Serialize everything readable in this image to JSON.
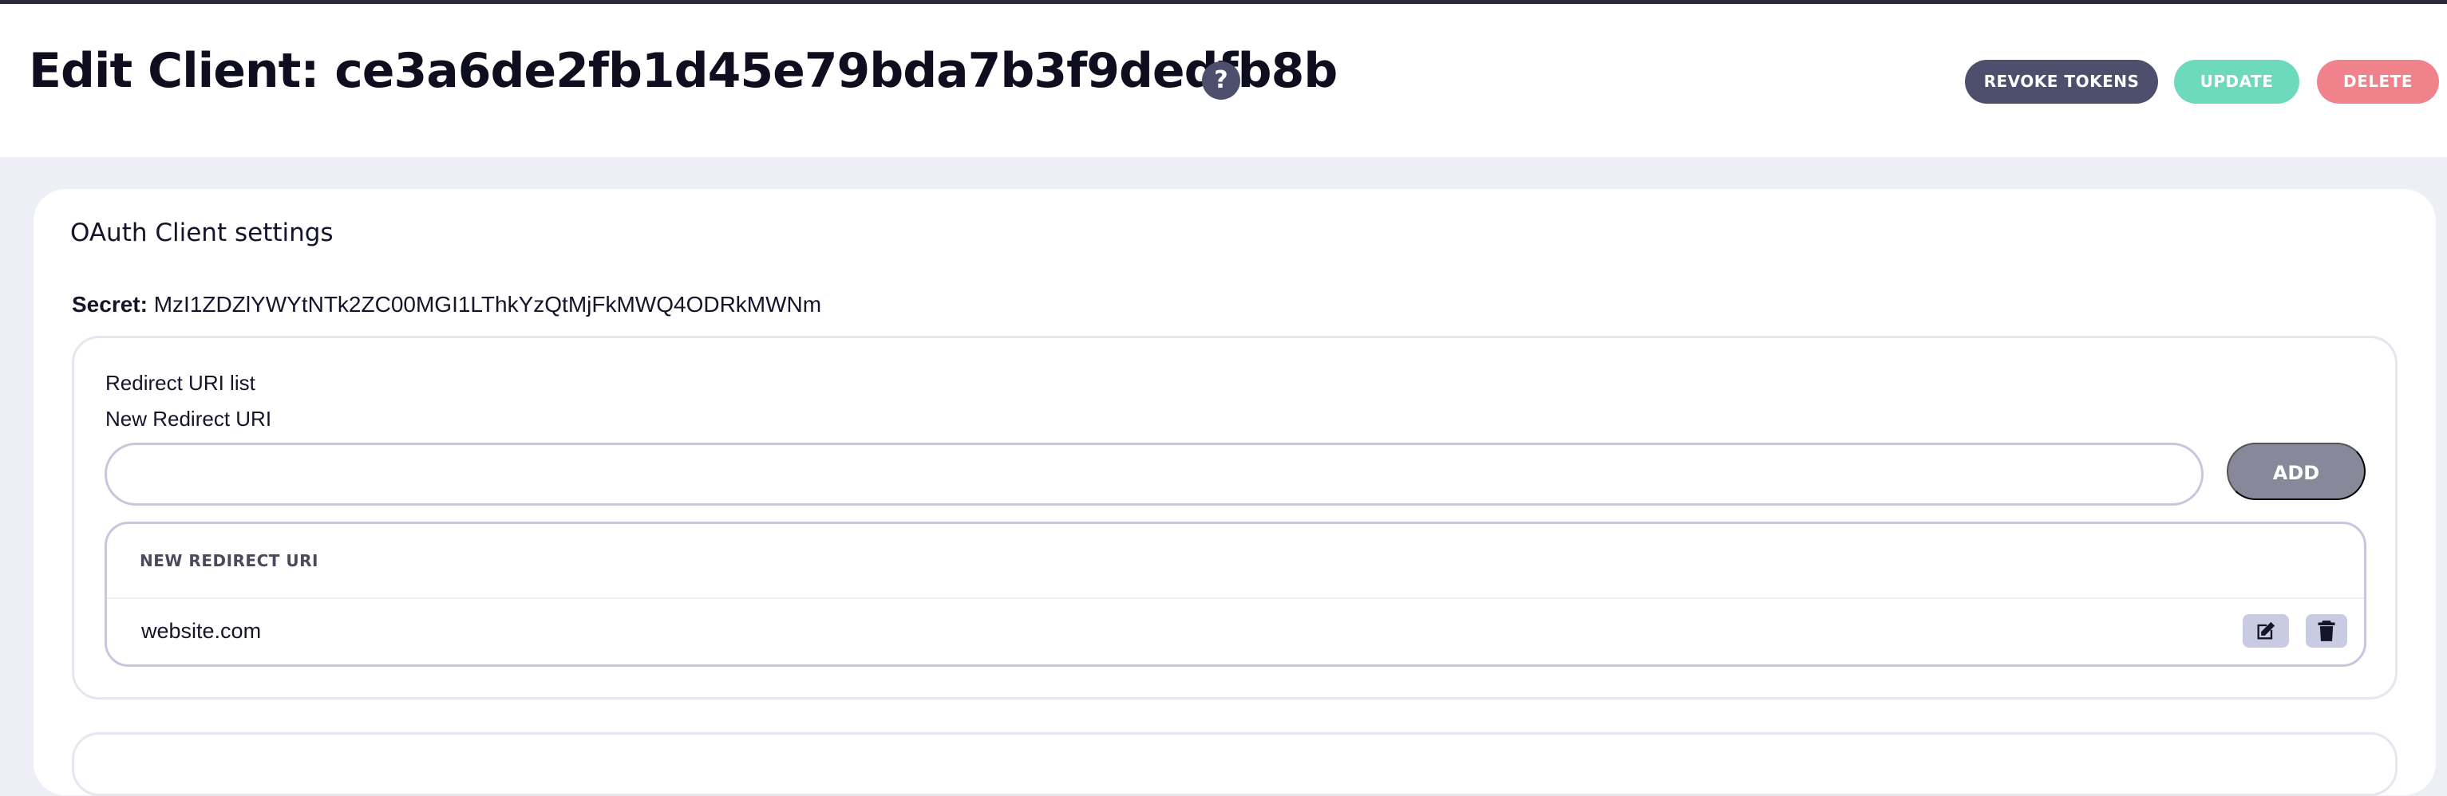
{
  "header": {
    "title": "Edit Client: ce3a6de2fb1d45e79bda7b3f9dedfb8b",
    "help_glyph": "?",
    "buttons": {
      "revoke": "REVOKE TOKENS",
      "update": "UPDATE",
      "delete": "DELETE"
    }
  },
  "settings": {
    "title": "OAuth Client settings",
    "secret_label": "Secret:",
    "secret_value": "MzI1ZDZlYWYtNTk2ZC00MGI1LThkYzQtMjFkMWQ4ODRkMWNm"
  },
  "redirect": {
    "list_label": "Redirect URI list",
    "new_label": "New Redirect URI",
    "input_value": "",
    "input_placeholder": "",
    "add_label": "ADD",
    "table": {
      "column_header": "NEW REDIRECT URI",
      "rows": [
        {
          "uri": "website.com"
        }
      ]
    }
  },
  "colors": {
    "revoke_button": "#4d4f6d",
    "update_button": "#6dd9bd",
    "delete_button": "#f0828b",
    "add_button": "#878899",
    "page_background": "#eeeef7"
  },
  "icons": [
    "help-icon",
    "edit-icon",
    "trash-icon"
  ]
}
